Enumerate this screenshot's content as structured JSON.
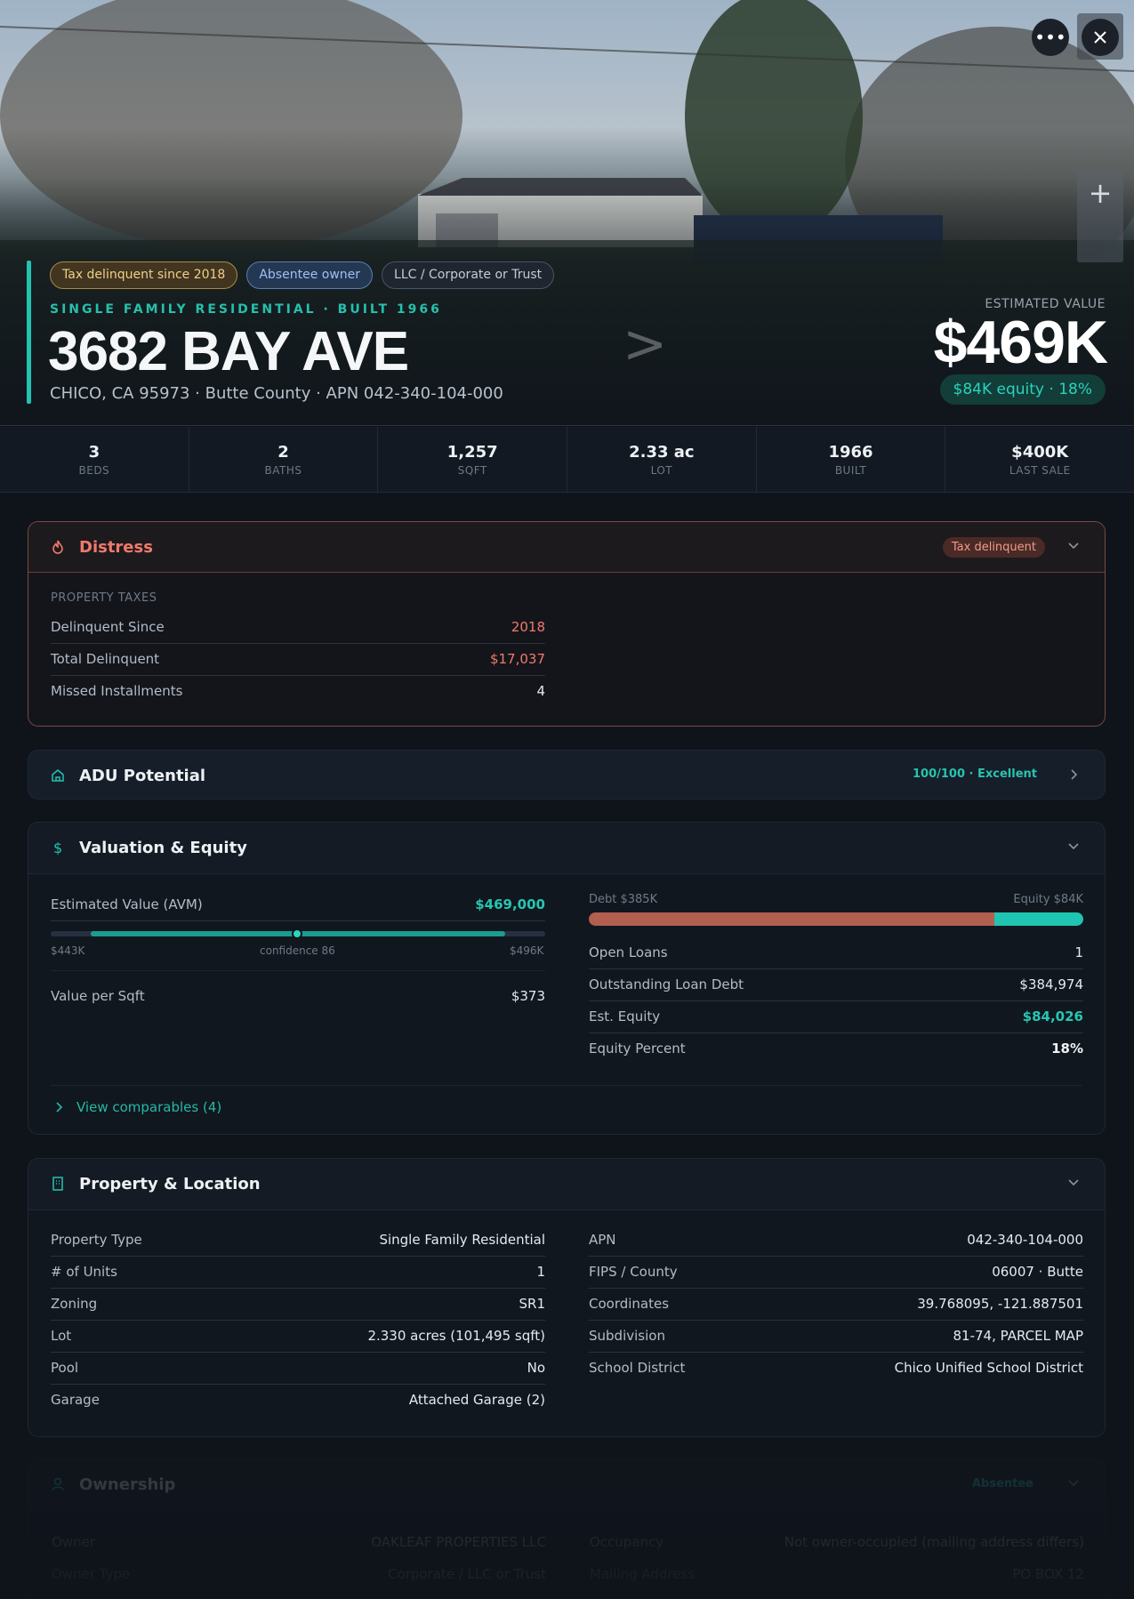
{
  "hero": {
    "tags": [
      "Tax delinquent since 2018",
      "Absentee owner",
      "LLC / Corporate or Trust"
    ],
    "subtitle": "SINGLE FAMILY RESIDENTIAL · BUILT 1966",
    "title": "3682 BAY AVE",
    "address_line": "CHICO, CA 95973 · Butte County · APN 042-340-104-000",
    "estimated_label": "ESTIMATED VALUE",
    "estimated_value": "$469K",
    "equity_pill": "$84K equity · 18%",
    "more_icon": "ellipsis-icon",
    "close_icon": "close-icon",
    "zoom_icon": "plus-icon"
  },
  "stats": [
    {
      "value": "3",
      "label": "BEDS"
    },
    {
      "value": "2",
      "label": "BATHS"
    },
    {
      "value": "1,257",
      "label": "SQFT"
    },
    {
      "value": "2.33 ac",
      "label": "LOT"
    },
    {
      "value": "1966",
      "label": "BUILT"
    },
    {
      "value": "$400K",
      "label": "LAST SALE"
    }
  ],
  "distress": {
    "title": "Distress",
    "badge": "Tax delinquent",
    "section_label": "PROPERTY TAXES",
    "rows": [
      {
        "k": "Delinquent Since",
        "v": "2018"
      },
      {
        "k": "Total Delinquent",
        "v": "$17,037"
      },
      {
        "k": "Missed Installments",
        "v": "4"
      }
    ]
  },
  "adu": {
    "title": "ADU Potential",
    "score": "100/100 · Excellent"
  },
  "valuation": {
    "title": "Valuation & Equity",
    "avm_label": "Estimated Value (AVM)",
    "avm_value": "$469,000",
    "range_low": "$443K",
    "range_mid": "confidence 86",
    "range_high": "$496K",
    "confidence": 86,
    "value_per_sqft_label": "Value per Sqft",
    "value_per_sqft": "$373",
    "debt_label": "Debt $385K",
    "equity_label": "Equity $84K",
    "debt_fraction": 0.82,
    "rows": [
      {
        "k": "Open Loans",
        "v": "1"
      },
      {
        "k": "Outstanding Loan Debt",
        "v": "$384,974"
      },
      {
        "k": "Est. Equity",
        "v": "$84,026"
      },
      {
        "k": "Equity Percent",
        "v": "18%"
      }
    ],
    "comps_link": "View comparables (4)"
  },
  "property": {
    "title": "Property & Location",
    "left": [
      {
        "k": "Property Type",
        "v": "Single Family Residential"
      },
      {
        "k": "# of Units",
        "v": "1"
      },
      {
        "k": "Zoning",
        "v": "SR1"
      },
      {
        "k": "Lot",
        "v": "2.330 acres (101,495 sqft)"
      },
      {
        "k": "Pool",
        "v": "No"
      },
      {
        "k": "Garage",
        "v": "Attached Garage (2)"
      }
    ],
    "right": [
      {
        "k": "APN",
        "v": "042-340-104-000"
      },
      {
        "k": "FIPS / County",
        "v": "06007 · Butte"
      },
      {
        "k": "Coordinates",
        "v": "39.768095, -121.887501"
      },
      {
        "k": "Subdivision",
        "v": "81-74, PARCEL MAP"
      },
      {
        "k": "School District",
        "v": "Chico Unified School District"
      }
    ]
  },
  "ownership": {
    "title": "Ownership",
    "badge": "Absentee",
    "left": [
      {
        "k": "Owner",
        "v": "OAKLEAF PROPERTIES LLC"
      },
      {
        "k": "Owner Type",
        "v": "Corporate / LLC or Trust"
      }
    ],
    "right": [
      {
        "k": "Occupancy",
        "v": "Not owner-occupied (mailing address differs)"
      },
      {
        "k": "Mailing Address",
        "v": "PO BOX 12"
      }
    ]
  },
  "colors": {
    "accent": "#22c3b0",
    "distress": "#f07a6a",
    "debt": "#b25e50"
  }
}
